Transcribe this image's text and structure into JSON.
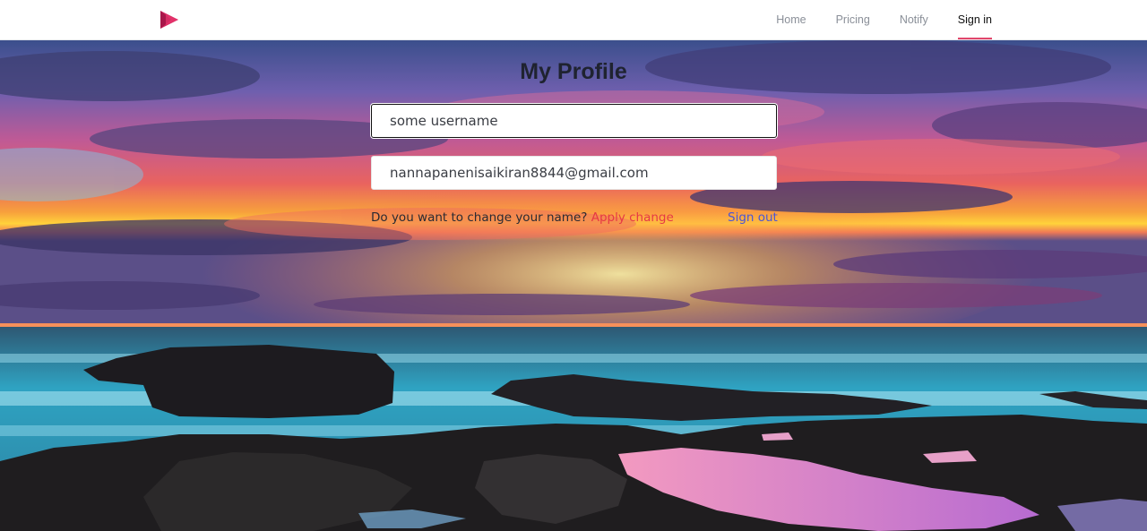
{
  "nav": {
    "logo_icon": "play-triangle-logo-icon",
    "links": [
      {
        "label": "Home",
        "active": false
      },
      {
        "label": "Pricing",
        "active": false
      },
      {
        "label": "Notify",
        "active": false
      },
      {
        "label": "Sign in",
        "active": true
      }
    ],
    "active_underline_color": "#e0466b"
  },
  "profile": {
    "title": "My Profile",
    "username_value": "some username",
    "email_value": "nannapanenisaikiran8844@gmail.com",
    "change_prompt": "Do you want to change your name? ",
    "apply_label": "Apply change",
    "sign_out_label": "Sign out"
  },
  "colors": {
    "apply_link": "#e63946",
    "sign_out_link": "#4a55d6",
    "brand": "#d6245e"
  },
  "background": {
    "image": "sunset-over-rocky-seashore"
  }
}
